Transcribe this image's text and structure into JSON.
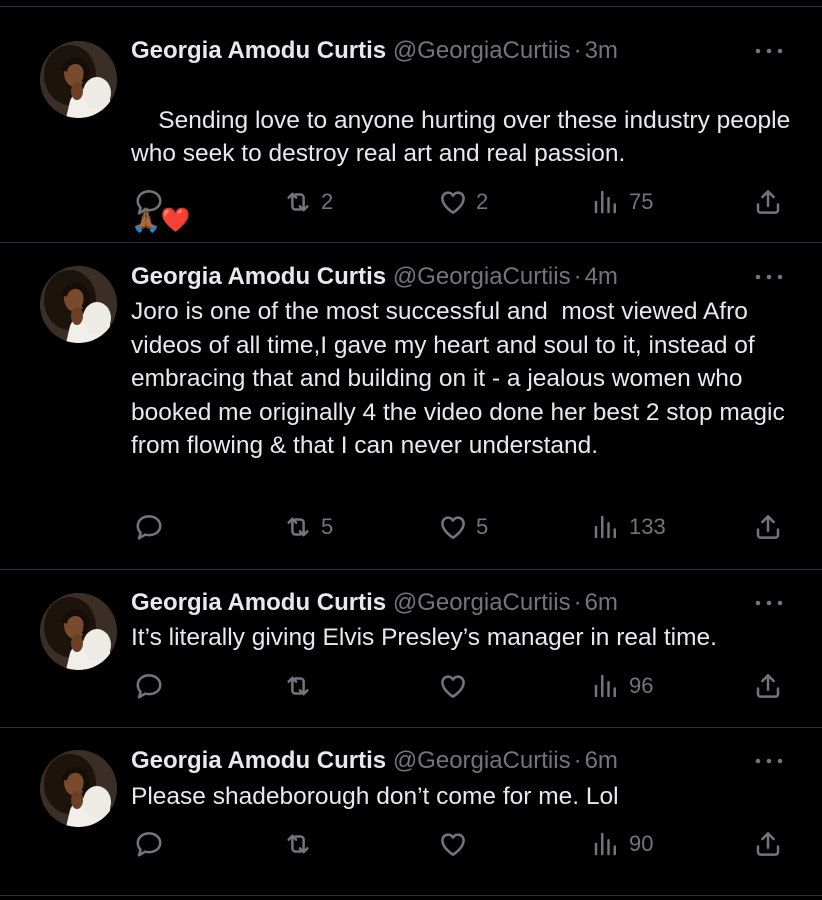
{
  "tweets": [
    {
      "name": "Georgia Amodu Curtis",
      "handle": "@GeorgiaCurtiis",
      "sep": "·",
      "time": "3m",
      "text": "Sending love to anyone hurting over these industry people who seek to destroy real art and real passion.",
      "emoji": "🙏🏾❤️",
      "reply_count": "",
      "retweet_count": "2",
      "like_count": "2",
      "view_count": "75"
    },
    {
      "name": "Georgia Amodu Curtis",
      "handle": "@GeorgiaCurtiis",
      "sep": "·",
      "time": "4m",
      "text": "Joro is one of the most successful and  most viewed Afro videos of all time,I gave my heart and soul to it, instead of embracing that and building on it - a jealous women who booked me originally 4 the video done her best 2 stop magic from flowing & that I can never understand.",
      "emoji": "",
      "reply_count": "",
      "retweet_count": "5",
      "like_count": "5",
      "view_count": "133"
    },
    {
      "name": "Georgia Amodu Curtis",
      "handle": "@GeorgiaCurtiis",
      "sep": "·",
      "time": "6m",
      "text": "It’s literally giving Elvis Presley’s manager in real time.",
      "emoji": "",
      "reply_count": "",
      "retweet_count": "",
      "like_count": "",
      "view_count": "96"
    },
    {
      "name": "Georgia Amodu Curtis",
      "handle": "@GeorgiaCurtiis",
      "sep": "·",
      "time": "6m",
      "text": "Please shadeborough don’t come for me. Lol",
      "emoji": "",
      "reply_count": "",
      "retweet_count": "",
      "like_count": "",
      "view_count": "90"
    }
  ],
  "icons": {
    "reply": "reply-icon",
    "retweet": "retweet-icon",
    "like": "heart-icon",
    "views": "views-icon",
    "share": "share-icon",
    "more": "more-icon"
  },
  "colors": {
    "background": "#000000",
    "text": "#e7e9ea",
    "muted": "#71767b",
    "divider": "#2f3336"
  }
}
